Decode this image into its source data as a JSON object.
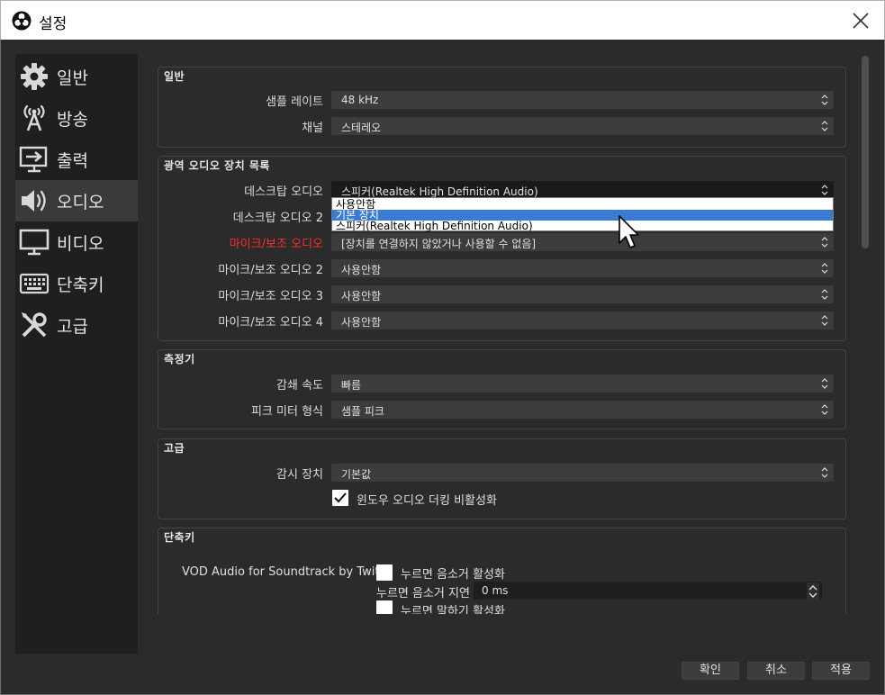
{
  "window": {
    "title": "설정"
  },
  "sidebar": {
    "items": [
      {
        "label": "일반",
        "icon": "gear-icon"
      },
      {
        "label": "방송",
        "icon": "broadcast-icon"
      },
      {
        "label": "출력",
        "icon": "output-icon"
      },
      {
        "label": "오디오",
        "icon": "speaker-icon",
        "active": true
      },
      {
        "label": "비디오",
        "icon": "monitor-icon"
      },
      {
        "label": "단축키",
        "icon": "keyboard-icon"
      },
      {
        "label": "고급",
        "icon": "tools-icon"
      }
    ]
  },
  "general": {
    "title": "일반",
    "sample_rate_label": "샘플 레이트",
    "sample_rate_value": "48 kHz",
    "channel_label": "채널",
    "channel_value": "스테레오"
  },
  "global_devices": {
    "title": "광역 오디오 장치 목록",
    "desktop1_label": "데스크탑 오디오",
    "desktop1_value": "스피커(Realtek High Definition Audio)",
    "desktop2_label": "데스크탑 오디오 2",
    "mic1_label": "마이크/보조 오디오",
    "mic1_value": "[장치를 연결하지 않았거나 사용할 수 없음]",
    "mic2_label": "마이크/보조 오디오 2",
    "mic2_value": "사용안함",
    "mic3_label": "마이크/보조 오디오 3",
    "mic3_value": "사용안함",
    "mic4_label": "마이크/보조 오디오 4",
    "mic4_value": "사용안함",
    "dropdown_options": [
      "사용안함",
      "기본 장치",
      "스피커(Realtek High Definition Audio)"
    ],
    "dropdown_selected_index": 1
  },
  "meters": {
    "title": "측정기",
    "decay_label": "감쇄 속도",
    "decay_value": "빠름",
    "peak_label": "피크 미터 형식",
    "peak_value": "샘플 피크"
  },
  "advanced": {
    "title": "고급",
    "monitor_label": "감시 장치",
    "monitor_value": "기본값",
    "ducking_label": "윈도우 오디오 더킹 비활성화",
    "ducking_checked": true
  },
  "hotkeys": {
    "title": "단축키",
    "source_label": "VOD Audio for Soundtrack by Twitch",
    "push_mute_label": "누르면 음소거 활성화",
    "push_mute_delay_label": "누르면 음소거 지연",
    "push_mute_delay_value": "0 ms",
    "push_talk_label": "누르면 말하기 활성화"
  },
  "buttons": {
    "ok": "확인",
    "cancel": "취소",
    "apply": "적용"
  },
  "colors": {
    "accent": "#3a7bd5",
    "error": "#ff2a2a",
    "bg": "#2b2b2b"
  }
}
